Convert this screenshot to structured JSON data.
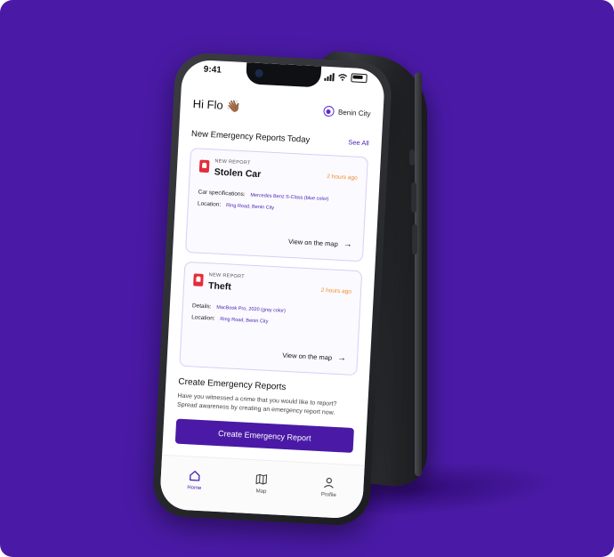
{
  "status": {
    "time": "9:41"
  },
  "header": {
    "greeting": "Hi Flo 👋🏾",
    "location": "Benin City"
  },
  "section": {
    "title": "New Emergency Reports Today",
    "see_all": "See All"
  },
  "reports": [
    {
      "kicker": "NEW REPORT",
      "title": "Stolen Car",
      "time": "2 hours ago",
      "details": [
        {
          "label": "Car specifications:",
          "value": "Mercedes Benz S-Class (blue color)"
        },
        {
          "label": "Location:",
          "value": "Ring Road, Benin City"
        }
      ],
      "action": "View on the map"
    },
    {
      "kicker": "NEW REPORT",
      "title": "Theft",
      "time": "2 hours ago",
      "details": [
        {
          "label": "Details:",
          "value": "MacBook Pro, 2020 (grey color)"
        },
        {
          "label": "Location:",
          "value": "Ring Road, Benin City"
        }
      ],
      "action": "View on the map"
    }
  ],
  "create": {
    "title": "Create Emergency Reports",
    "description": "Have you witnessed a crime that you would like to report? Spread awareness by creating an emergency report now.",
    "button": "Create Emergency Report"
  },
  "tabs": [
    {
      "label": "Home",
      "icon": "home-icon",
      "active": true
    },
    {
      "label": "Map",
      "icon": "map-icon",
      "active": false
    },
    {
      "label": "Profile",
      "icon": "profile-icon",
      "active": false
    }
  ],
  "colors": {
    "brand": "#4a1aa6",
    "accent": "#4a22b4",
    "time": "#f08a2c",
    "alert": "#e32d3c"
  }
}
